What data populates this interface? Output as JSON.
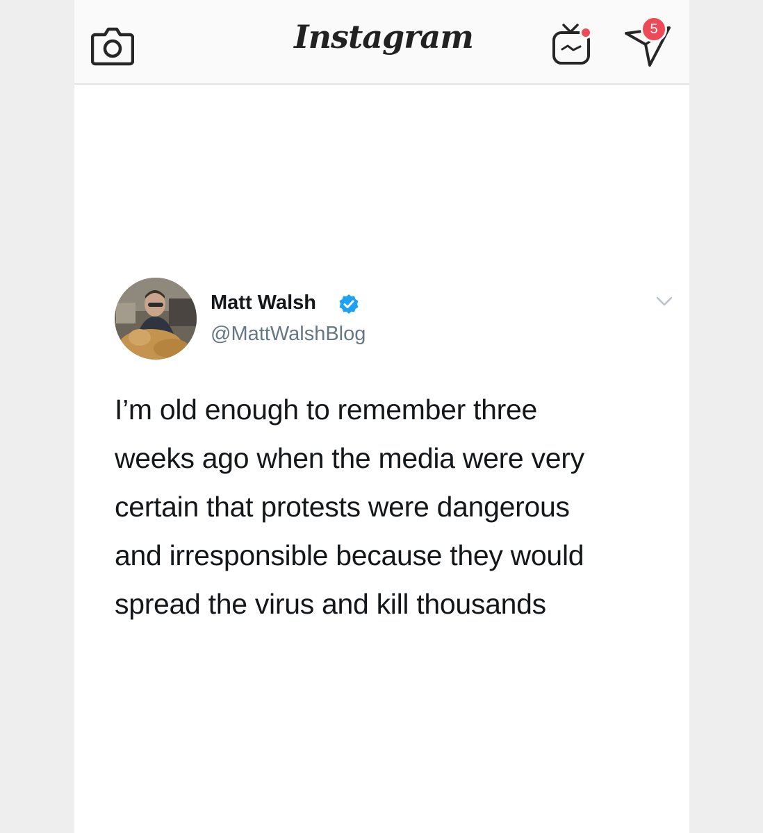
{
  "app": {
    "title": "Instagram",
    "accent_color": "#ed4956",
    "icons": {
      "camera": "camera-icon",
      "igtv": "igtv-icon",
      "direct": "paper-plane-icon"
    },
    "direct_badge_count": "5"
  },
  "tweet": {
    "author_name": "Matt Walsh",
    "verified": true,
    "verified_color": "#1da1f2",
    "handle": "@MattWalshBlog",
    "text_lines": [
      "I’m old enough to remember three",
      "weeks ago when the media were very",
      "certain that protests were dangerous",
      "and irresponsible because they would",
      "spread the virus and kill thousands"
    ]
  }
}
